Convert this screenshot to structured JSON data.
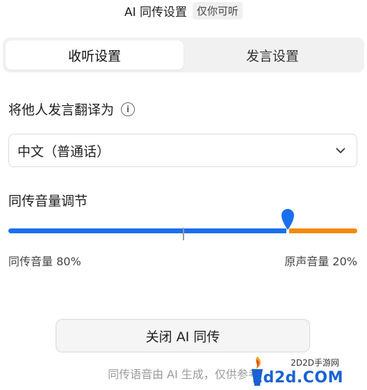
{
  "header": {
    "title": "AI 同传设置",
    "badge": "仅你可听"
  },
  "tabs": [
    {
      "label": "收听设置",
      "active": true
    },
    {
      "label": "发言设置",
      "active": false
    }
  ],
  "translate": {
    "label": "将他人发言翻译为",
    "info_icon": "info-icon",
    "selected": "中文（普通话）",
    "dropdown_icon": "chevron-down-icon"
  },
  "volume": {
    "label": "同传音量调节",
    "left_caption": "同传音量 80%",
    "right_caption": "原声音量 20%",
    "interpretation_percent": 80,
    "original_percent": 20,
    "left_color": "#1a6ff0",
    "right_color": "#f28b07"
  },
  "close_button": {
    "label": "关闭 AI 同传"
  },
  "footnote": "同传语音由 AI 生成，仅供参考",
  "watermark": {
    "small": "2D2D手游网",
    "big": "2d2d.COM"
  }
}
